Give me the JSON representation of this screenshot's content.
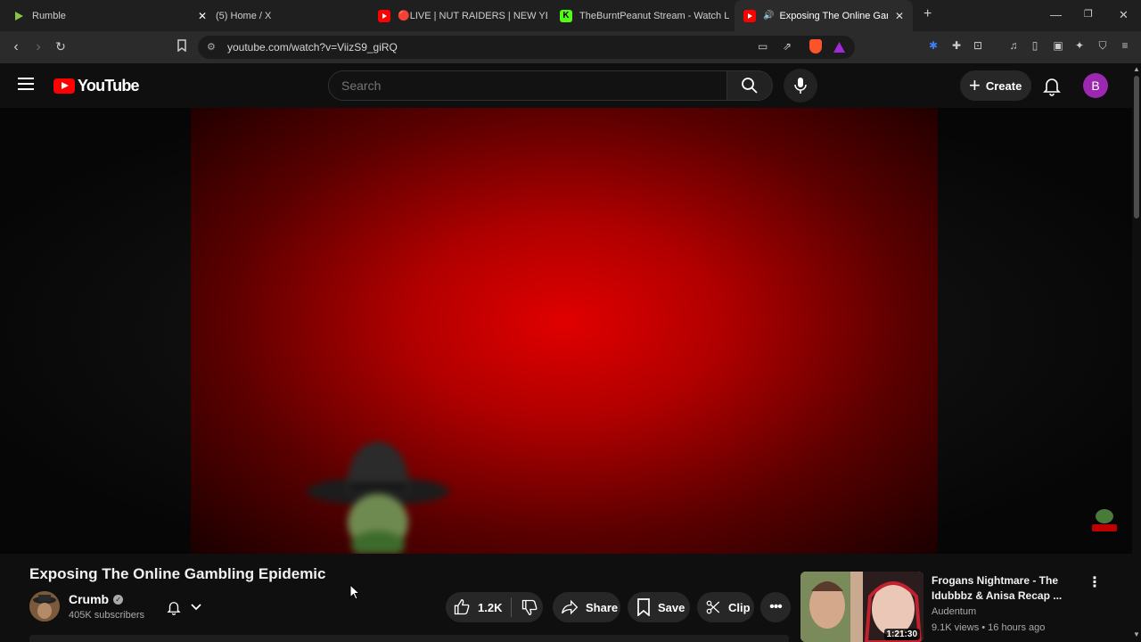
{
  "browser": {
    "tabs": [
      {
        "title": "Rumble",
        "icon": "rumble-icon",
        "color": "#85c742"
      },
      {
        "title": "(5) Home / X",
        "icon": "x-icon",
        "color": "#ffffff"
      },
      {
        "title": "🔴LIVE | NUT RAIDERS | NEW YEAR",
        "icon": "youtube-icon",
        "color": "#ff0000"
      },
      {
        "title": "TheBurntPeanut Stream - Watch Live",
        "icon": "kick-icon",
        "color": "#53fc18"
      },
      {
        "title": "Exposing The Online Gamblin",
        "icon": "youtube-icon",
        "color": "#ff0000",
        "active": true
      }
    ],
    "new_tab": "+",
    "url": "youtube.com/watch?v=ViizS9_giRQ"
  },
  "youtube": {
    "logo_text": "YouTube",
    "search_placeholder": "Search",
    "create_label": "Create",
    "avatar_letter": "B",
    "avatar_color": "#9c27b0"
  },
  "video": {
    "title": "Exposing The Online Gambling Epidemic",
    "channel_name": "Crumb",
    "subscribers": "405K subscribers",
    "likes": "1.2K",
    "share_label": "Share",
    "save_label": "Save",
    "clip_label": "Clip"
  },
  "recommended": {
    "title": "Frogans Nightmare - The Idubbbz & Anisa Recap ...",
    "channel": "Audentum",
    "meta": "9.1K views • 16 hours ago",
    "duration": "1:21:30"
  }
}
